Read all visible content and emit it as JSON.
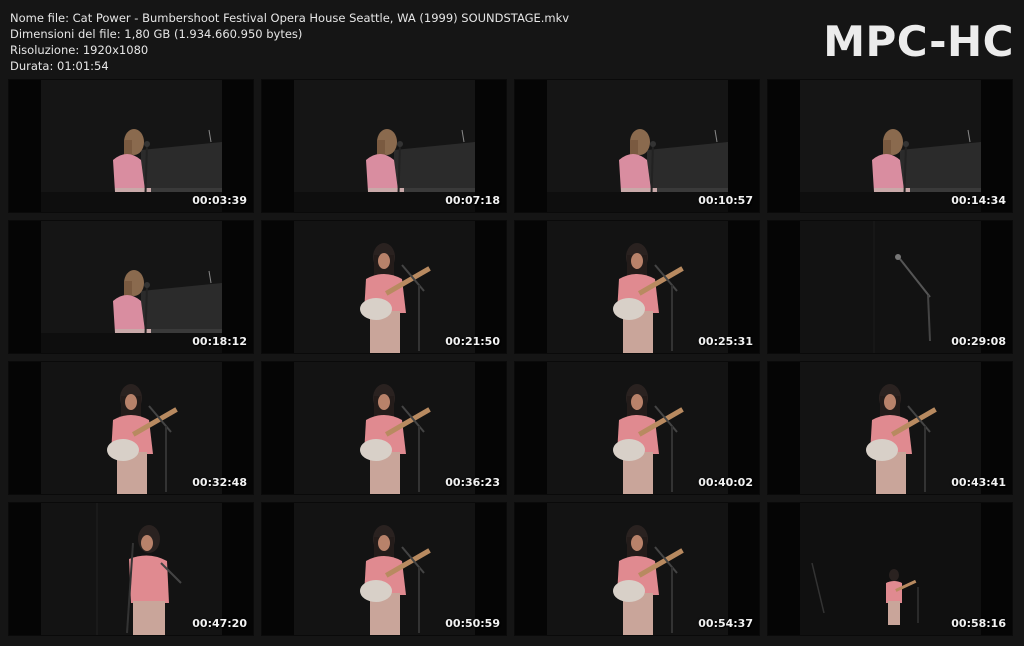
{
  "header": {
    "file_name": "Nome file: Cat Power - Bumbershoot Festival Opera House Seattle, WA (1999) SOUNDSTAGE.mkv",
    "file_size": "Dimensioni del file: 1,80 GB (1.934.660.950 bytes)",
    "resolution": "Risoluzione: 1920x1080",
    "duration": "Durata: 01:01:54",
    "logo": "MPC-HC"
  },
  "thumbnails": [
    {
      "time": "00:03:39",
      "scene": "piano"
    },
    {
      "time": "00:07:18",
      "scene": "piano"
    },
    {
      "time": "00:10:57",
      "scene": "piano"
    },
    {
      "time": "00:14:34",
      "scene": "piano"
    },
    {
      "time": "00:18:12",
      "scene": "piano"
    },
    {
      "time": "00:21:50",
      "scene": "guitar"
    },
    {
      "time": "00:25:31",
      "scene": "guitar"
    },
    {
      "time": "00:29:08",
      "scene": "mic-only"
    },
    {
      "time": "00:32:48",
      "scene": "guitar"
    },
    {
      "time": "00:36:23",
      "scene": "guitar"
    },
    {
      "time": "00:40:02",
      "scene": "guitar"
    },
    {
      "time": "00:43:41",
      "scene": "guitar"
    },
    {
      "time": "00:47:20",
      "scene": "standing"
    },
    {
      "time": "00:50:59",
      "scene": "guitar"
    },
    {
      "time": "00:54:37",
      "scene": "guitar"
    },
    {
      "time": "00:58:16",
      "scene": "wide"
    }
  ]
}
